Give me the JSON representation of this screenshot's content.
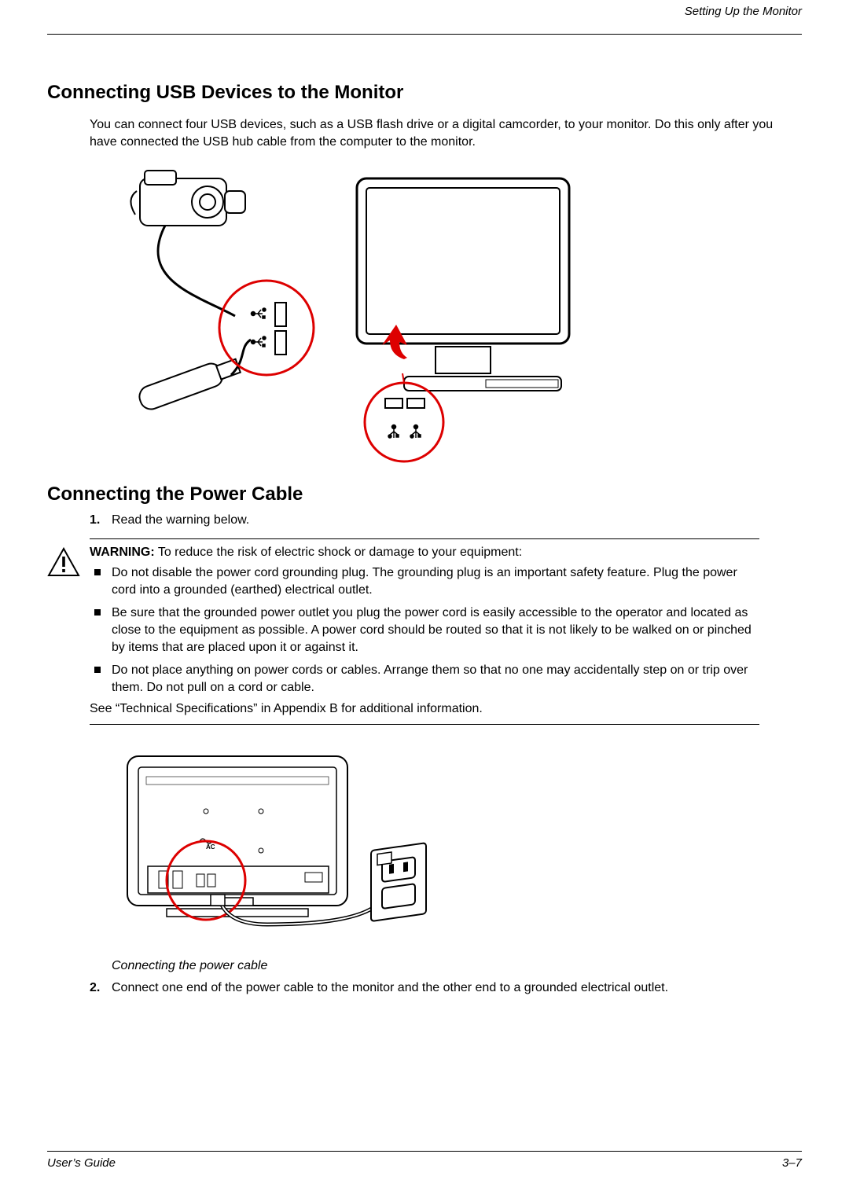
{
  "header": {
    "running_head": "Setting Up the Monitor"
  },
  "section1": {
    "heading": "Connecting USB Devices to the Monitor",
    "intro": "You can connect four USB devices, such as a USB flash drive or a digital camcorder, to your monitor. Do this only after you have connected the USB hub cable from the computer to the monitor."
  },
  "section2": {
    "heading": "Connecting the Power Cable",
    "step1_num": "1.",
    "step1_text": "Read the warning below.",
    "warning_label": "WARNING:",
    "warning_intro": " To reduce the risk of electric shock or damage to your equipment:",
    "bullets": [
      "Do not disable the power cord grounding plug. The grounding plug is an important safety feature. Plug the power cord into a grounded (earthed) electrical outlet.",
      "Be sure that the grounded power outlet you plug the power cord is easily accessible to the operator and located as close to the equipment as possible. A power cord should be routed so that it is not likely to be walked on or pinched by items that are placed upon it or against it.",
      "Do not place anything on power cords or cables. Arrange them so that no one may accidentally step on or trip over them. Do not pull on a cord or cable."
    ],
    "see_note": "See “Technical Specifications” in Appendix B for additional information.",
    "figure_caption": "Connecting the power cable",
    "step2_num": "2.",
    "step2_text": "Connect one end of the power cable to the monitor and the other end to a grounded electrical outlet."
  },
  "footer": {
    "left": "User’s Guide",
    "right": "3–7"
  }
}
